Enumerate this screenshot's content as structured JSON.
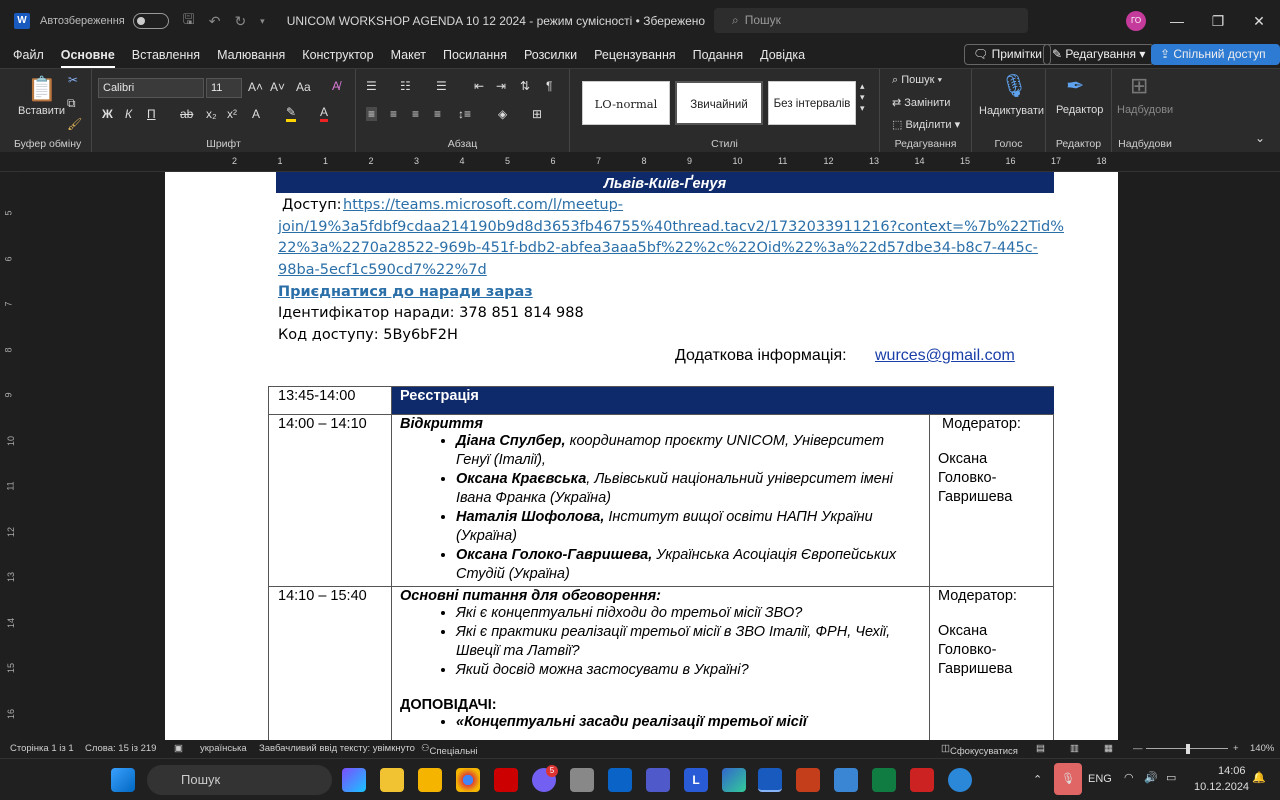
{
  "title_bar": {
    "autosave_label": "Автозбереження",
    "doc_title": "UNICOM WORKSHOP AGENDA 10 12  2024  -  режим сумісності • Збережено",
    "search_placeholder": "Пошук",
    "avatar_initials": "ГО"
  },
  "menu": {
    "items": [
      "Файл",
      "Основне",
      "Вставлення",
      "Малювання",
      "Конструктор",
      "Макет",
      "Посилання",
      "Розсилки",
      "Рецензування",
      "Подання",
      "Довідка"
    ],
    "active": "Основне",
    "notes_button": "Примітки",
    "editing_button": "Редагування",
    "share_button": "Спільний доступ"
  },
  "ribbon": {
    "clipboard": {
      "paste": "Вставити",
      "label": "Буфер обміну"
    },
    "font": {
      "name": "Calibri",
      "size": "11",
      "label": "Шрифт"
    },
    "paragraph": {
      "label": "Абзац"
    },
    "styles": {
      "items": [
        "LO-normal",
        "Звичайний",
        "Без інтервалів"
      ],
      "label": "Стилі"
    },
    "editing": {
      "find": "Пошук",
      "replace": "Замінити",
      "select": "Виділити",
      "label": "Редагування"
    },
    "voice": {
      "dictate": "Надиктувати",
      "label": "Голос"
    },
    "editor": {
      "button": "Редактор",
      "label": "Редактор"
    },
    "addins": {
      "button": "Надбудови",
      "label": "Надбудови"
    }
  },
  "ruler_numbers": [
    "2",
    "1",
    "1",
    "2",
    "3",
    "4",
    "5",
    "6",
    "7",
    "8",
    "9",
    "10",
    "11",
    "12",
    "13",
    "14",
    "15",
    "16",
    "17",
    "18"
  ],
  "vruler_numbers": [
    "5",
    "6",
    "7",
    "8",
    "9",
    "10",
    "11",
    "12",
    "13",
    "14",
    "15",
    "16",
    "17"
  ],
  "document": {
    "route": "Львів-Київ-Ґенуя",
    "access_label": "Доступ:",
    "access_url_lines": [
      "https://teams.microsoft.com/l/meetup-",
      "join/19%3a5fdbf9cdaa214190b9d8d3653fb46755%40thread.tacv2/1732033911216?context=%7b%22Tid%",
      "22%3a%2270a28522-969b-451f-bdb2-abfea3aaa5bf%22%2c%22Oid%22%3a%22d57dbe34-b8c7-445c-",
      "98ba-5ecf1c590cd7%22%7d"
    ],
    "join_link": "Приєднатися до наради зараз",
    "meeting_id": "Ідентифікатор наради: 378 851 814 988",
    "access_code": "Код доступу: 5By6bF2H",
    "extra_info_label": "Додаткова інформація:",
    "extra_info_email": "wurces@gmail.com",
    "table": [
      {
        "time": "13:45-14:00",
        "title": "Реєстрація",
        "moderator": "",
        "header": true
      },
      {
        "time": "14:00 – 14:10",
        "title": "Відкриття",
        "items": [
          {
            "name": "Діана Спулбер,",
            "rest": " координатор проєкту UNICOM, Університет Генуї (Італії),"
          },
          {
            "name": "Оксана Краєвська",
            "rest": ", Львівський національний університет імені Івана Франка (Україна)"
          },
          {
            "name": "Наталія Шофолова,",
            "rest": " Інститут вищої освіти НАПН України (Україна)"
          },
          {
            "name": "Оксана Голоко-Гавришева,",
            "rest": " Українська Асоціація Європейських Студій (Україна)"
          }
        ],
        "moderator_label": "Модератор:",
        "moderator": "Оксана Головко-Гавришева"
      },
      {
        "time": "14:10 – 15:40",
        "title": "Основні питання для обговорення:",
        "items": [
          {
            "name": "",
            "rest": "Які є концептуальні підходи до третьої місії ЗВО?"
          },
          {
            "name": "",
            "rest": "Які є практики реалізації третьої місії в ЗВО Італії, ФРН, Чехії, Швеції та Латвії?"
          },
          {
            "name": "",
            "rest": "Який досвід можна застосувати в Україні?"
          }
        ],
        "speakers_label": "ДОПОВІДАЧІ:",
        "speaker_item": "«Концептуальні засади реалізації третьої місії",
        "moderator_label": "Модератор:",
        "moderator": "Оксана Головко-Гавришева"
      }
    ]
  },
  "status_bar": {
    "page": "Сторінка 1 із 1",
    "words": "Слова: 15 із 219",
    "language": "українська",
    "predict": "Завбачливий ввід тексту: увімкнуто",
    "accessibility": "Спеціальні можливості: недоступні",
    "focus": "Сфокусуватися",
    "zoom": "140%"
  },
  "taskbar": {
    "search": "Пошук",
    "lang": "ENG",
    "time": "14:06",
    "date": "10.12.2024",
    "viber_badge": "5"
  }
}
